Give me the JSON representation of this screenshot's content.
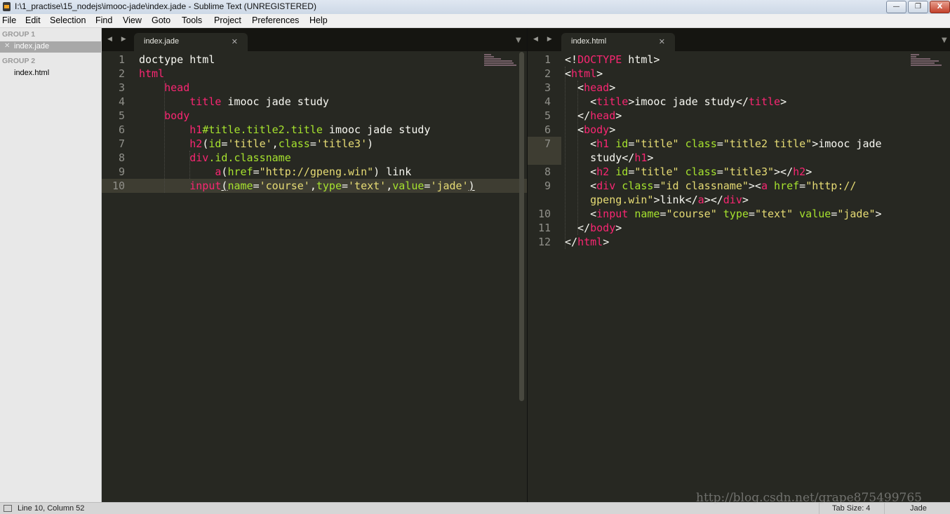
{
  "window": {
    "title": "I:\\1_practise\\15_nodejs\\imooc-jade\\index.jade - Sublime Text (UNREGISTERED)",
    "controls": {
      "minimize": "—",
      "maximize": "❐",
      "close": "X"
    }
  },
  "menu": [
    "File",
    "Edit",
    "Selection",
    "Find",
    "View",
    "Goto",
    "Tools",
    "Project",
    "Preferences",
    "Help"
  ],
  "sidebar": {
    "groups": [
      {
        "label": "GROUP 1",
        "files": [
          {
            "name": "index.jade",
            "active": true
          }
        ]
      },
      {
        "label": "GROUP 2",
        "files": [
          {
            "name": "index.html",
            "active": false
          }
        ]
      }
    ]
  },
  "panes": [
    {
      "tab": "index.jade",
      "current_line": 10,
      "lines": [
        {
          "n": "1",
          "tokens": [
            [
              "t",
              "doctype html"
            ]
          ]
        },
        {
          "n": "2",
          "tokens": [
            [
              "k",
              "html"
            ]
          ]
        },
        {
          "n": "3",
          "tokens": [
            [
              "t",
              "    "
            ],
            [
              "k",
              "head"
            ]
          ]
        },
        {
          "n": "4",
          "tokens": [
            [
              "t",
              "        "
            ],
            [
              "k",
              "title"
            ],
            [
              "t",
              " imooc jade study"
            ]
          ]
        },
        {
          "n": "5",
          "tokens": [
            [
              "t",
              "    "
            ],
            [
              "k",
              "body"
            ]
          ]
        },
        {
          "n": "6",
          "tokens": [
            [
              "t",
              "        "
            ],
            [
              "k",
              "h1"
            ],
            [
              "a",
              "#title.title2.title"
            ],
            [
              "t",
              " imooc jade study"
            ]
          ]
        },
        {
          "n": "7",
          "tokens": [
            [
              "t",
              "        "
            ],
            [
              "k",
              "h2"
            ],
            [
              "t",
              "("
            ],
            [
              "a",
              "id"
            ],
            [
              "t",
              "="
            ],
            [
              "s",
              "'title'"
            ],
            [
              "t",
              ","
            ],
            [
              "a",
              "class"
            ],
            [
              "t",
              "="
            ],
            [
              "s",
              "'title3'"
            ],
            [
              "t",
              ")"
            ]
          ]
        },
        {
          "n": "8",
          "tokens": [
            [
              "t",
              "        "
            ],
            [
              "k",
              "div"
            ],
            [
              "a",
              ".id.classname"
            ]
          ]
        },
        {
          "n": "9",
          "tokens": [
            [
              "t",
              "            "
            ],
            [
              "k",
              "a"
            ],
            [
              "t",
              "("
            ],
            [
              "a",
              "href"
            ],
            [
              "t",
              "="
            ],
            [
              "s",
              "\"http://gpeng.win\""
            ],
            [
              "t",
              ") link"
            ]
          ]
        },
        {
          "n": "10",
          "tokens": [
            [
              "t",
              "        "
            ],
            [
              "k",
              "input"
            ],
            [
              "u",
              "("
            ],
            [
              "a",
              "name"
            ],
            [
              "t",
              "="
            ],
            [
              "s",
              "'course'"
            ],
            [
              "t",
              ","
            ],
            [
              "a",
              "type"
            ],
            [
              "t",
              "="
            ],
            [
              "s",
              "'text'"
            ],
            [
              "t",
              ","
            ],
            [
              "a",
              "value"
            ],
            [
              "t",
              "="
            ],
            [
              "s",
              "'jade'"
            ],
            [
              "u",
              ")"
            ]
          ]
        }
      ]
    },
    {
      "tab": "index.html",
      "current_line": 7,
      "lines": [
        {
          "n": "1",
          "tokens": [
            [
              "t",
              "<!"
            ],
            [
              "k",
              "DOCTYPE"
            ],
            [
              "t",
              " html>"
            ]
          ]
        },
        {
          "n": "2",
          "tokens": [
            [
              "t",
              "<"
            ],
            [
              "k",
              "html"
            ],
            [
              "t",
              ">"
            ]
          ]
        },
        {
          "n": "3",
          "tokens": [
            [
              "t",
              "  <"
            ],
            [
              "k",
              "head"
            ],
            [
              "t",
              ">"
            ]
          ]
        },
        {
          "n": "4",
          "tokens": [
            [
              "t",
              "    <"
            ],
            [
              "k",
              "title"
            ],
            [
              "t",
              ">imooc jade study</"
            ],
            [
              "k",
              "title"
            ],
            [
              "t",
              ">"
            ]
          ]
        },
        {
          "n": "5",
          "tokens": [
            [
              "t",
              "  </"
            ],
            [
              "k",
              "head"
            ],
            [
              "t",
              ">"
            ]
          ]
        },
        {
          "n": "6",
          "tokens": [
            [
              "t",
              "  <"
            ],
            [
              "k",
              "body"
            ],
            [
              "t",
              ">"
            ]
          ]
        },
        {
          "n": "7",
          "tokens": [
            [
              "t",
              "    <"
            ],
            [
              "k",
              "h1"
            ],
            [
              "t",
              " "
            ],
            [
              "a",
              "id"
            ],
            [
              "t",
              "="
            ],
            [
              "s",
              "\"title\""
            ],
            [
              "t",
              " "
            ],
            [
              "a",
              "class"
            ],
            [
              "t",
              "="
            ],
            [
              "s",
              "\"title2 title\""
            ],
            [
              "t",
              ">imooc jade"
            ]
          ]
        },
        {
          "n": "",
          "tokens": [
            [
              "t",
              "    study</"
            ],
            [
              "k",
              "h1"
            ],
            [
              "t",
              ">"
            ]
          ]
        },
        {
          "n": "8",
          "tokens": [
            [
              "t",
              "    <"
            ],
            [
              "k",
              "h2"
            ],
            [
              "t",
              " "
            ],
            [
              "a",
              "id"
            ],
            [
              "t",
              "="
            ],
            [
              "s",
              "\"title\""
            ],
            [
              "t",
              " "
            ],
            [
              "a",
              "class"
            ],
            [
              "t",
              "="
            ],
            [
              "s",
              "\"title3\""
            ],
            [
              "t",
              "></"
            ],
            [
              "k",
              "h2"
            ],
            [
              "t",
              ">"
            ]
          ]
        },
        {
          "n": "9",
          "tokens": [
            [
              "t",
              "    <"
            ],
            [
              "k",
              "div"
            ],
            [
              "t",
              " "
            ],
            [
              "a",
              "class"
            ],
            [
              "t",
              "="
            ],
            [
              "s",
              "\"id classname\""
            ],
            [
              "t",
              "><"
            ],
            [
              "k",
              "a"
            ],
            [
              "t",
              " "
            ],
            [
              "a",
              "href"
            ],
            [
              "t",
              "="
            ],
            [
              "s",
              "\"http://"
            ]
          ]
        },
        {
          "n": "",
          "tokens": [
            [
              "s",
              "    gpeng.win\""
            ],
            [
              "t",
              ">link</"
            ],
            [
              "k",
              "a"
            ],
            [
              "t",
              "></"
            ],
            [
              "k",
              "div"
            ],
            [
              "t",
              ">"
            ]
          ]
        },
        {
          "n": "10",
          "tokens": [
            [
              "t",
              "    <"
            ],
            [
              "k",
              "input"
            ],
            [
              "t",
              " "
            ],
            [
              "a",
              "name"
            ],
            [
              "t",
              "="
            ],
            [
              "s",
              "\"course\""
            ],
            [
              "t",
              " "
            ],
            [
              "a",
              "type"
            ],
            [
              "t",
              "="
            ],
            [
              "s",
              "\"text\""
            ],
            [
              "t",
              " "
            ],
            [
              "a",
              "value"
            ],
            [
              "t",
              "="
            ],
            [
              "s",
              "\"jade\""
            ],
            [
              "t",
              ">"
            ]
          ]
        },
        {
          "n": "11",
          "tokens": [
            [
              "t",
              "  </"
            ],
            [
              "k",
              "body"
            ],
            [
              "t",
              ">"
            ]
          ]
        },
        {
          "n": "12",
          "tokens": [
            [
              "t",
              "</"
            ],
            [
              "k",
              "html"
            ],
            [
              "t",
              ">"
            ]
          ]
        }
      ]
    }
  ],
  "status": {
    "position": "Line 10, Column 52",
    "tab_size": "Tab Size: 4",
    "syntax": "Jade"
  },
  "watermark": "http://blog.csdn.net/grape875499765",
  "colors": {
    "background": "#272822",
    "keyword": "#f92672",
    "string": "#e6db74",
    "attribute": "#a6e22e",
    "text": "#f8f8f2"
  }
}
